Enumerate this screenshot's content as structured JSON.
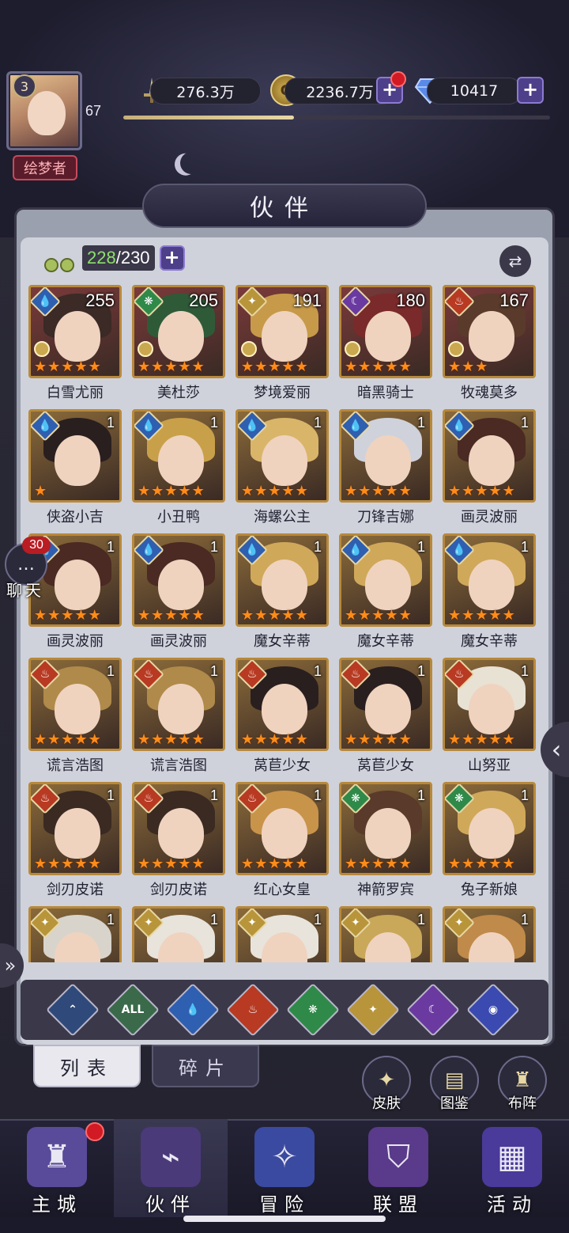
{
  "player": {
    "vip_level": "3",
    "level": "67",
    "title": "绘梦者",
    "exp_progress": 0.4
  },
  "resources": {
    "power": "276.3万",
    "gold": "2236.7万",
    "gems": "10417"
  },
  "header": {
    "title": "伙伴"
  },
  "roster": {
    "current": "228",
    "max": "/230"
  },
  "heroes": [
    {
      "name": "白雪尤丽",
      "level": "255",
      "element": "water",
      "stars": 5,
      "chess": true,
      "hair": "#3b2a26",
      "bg": "#7a3a3a"
    },
    {
      "name": "美杜莎",
      "level": "205",
      "element": "wind",
      "stars": 5,
      "chess": true,
      "hair": "#2f5a38",
      "bg": "#7a3a3a"
    },
    {
      "name": "梦境爱丽",
      "level": "191",
      "element": "light",
      "stars": 5,
      "chess": true,
      "hair": "#c79a4a",
      "bg": "#7a3a3a"
    },
    {
      "name": "暗黑骑士",
      "level": "180",
      "element": "dark",
      "stars": 5,
      "chess": true,
      "hair": "#7a2a2a",
      "bg": "#7a3a3a"
    },
    {
      "name": "牧魂莫多",
      "level": "167",
      "element": "fire",
      "stars": 3,
      "chess": true,
      "hair": "#5a3a2a",
      "bg": "#7a3a3a"
    },
    {
      "name": "侠盗小吉",
      "level": "1",
      "element": "water",
      "stars": 1,
      "chess": false,
      "hair": "#2a1f1f",
      "bg": "#8a6a3a"
    },
    {
      "name": "小丑鸭",
      "level": "1",
      "element": "water",
      "stars": 5,
      "chess": false,
      "hair": "#c9a04a",
      "bg": "#8a6a3a"
    },
    {
      "name": "海螺公主",
      "level": "1",
      "element": "water",
      "stars": 5,
      "chess": false,
      "hair": "#d9b56a",
      "bg": "#8a6a3a"
    },
    {
      "name": "刀锋吉娜",
      "level": "1",
      "element": "water",
      "stars": 5,
      "chess": false,
      "hair": "#cfd2db",
      "bg": "#8a6a3a"
    },
    {
      "name": "画灵波丽",
      "level": "1",
      "element": "water",
      "stars": 5,
      "chess": false,
      "hair": "#4a2a22",
      "bg": "#8a6a3a"
    },
    {
      "name": "画灵波丽",
      "level": "1",
      "element": "water",
      "stars": 5,
      "chess": false,
      "hair": "#4a2a22",
      "bg": "#8a6a3a"
    },
    {
      "name": "画灵波丽",
      "level": "1",
      "element": "water",
      "stars": 5,
      "chess": false,
      "hair": "#4a2a22",
      "bg": "#8a6a3a"
    },
    {
      "name": "魔女辛蒂",
      "level": "1",
      "element": "water",
      "stars": 5,
      "chess": false,
      "hair": "#d0a85a",
      "bg": "#8a6a3a"
    },
    {
      "name": "魔女辛蒂",
      "level": "1",
      "element": "water",
      "stars": 5,
      "chess": false,
      "hair": "#d0a85a",
      "bg": "#8a6a3a"
    },
    {
      "name": "魔女辛蒂",
      "level": "1",
      "element": "water",
      "stars": 5,
      "chess": false,
      "hair": "#d0a85a",
      "bg": "#8a6a3a"
    },
    {
      "name": "谎言浩图",
      "level": "1",
      "element": "fire",
      "stars": 5,
      "chess": false,
      "hair": "#b08a4a",
      "bg": "#8a6a3a"
    },
    {
      "name": "谎言浩图",
      "level": "1",
      "element": "fire",
      "stars": 5,
      "chess": false,
      "hair": "#b08a4a",
      "bg": "#8a6a3a"
    },
    {
      "name": "莴苣少女",
      "level": "1",
      "element": "fire",
      "stars": 5,
      "chess": false,
      "hair": "#2a1f1f",
      "bg": "#8a6a3a"
    },
    {
      "name": "莴苣少女",
      "level": "1",
      "element": "fire",
      "stars": 5,
      "chess": false,
      "hair": "#2a1f1f",
      "bg": "#8a6a3a"
    },
    {
      "name": "山努亚",
      "level": "1",
      "element": "fire",
      "stars": 5,
      "chess": false,
      "hair": "#e8e2d5",
      "bg": "#8a6a3a"
    },
    {
      "name": "剑刃皮诺",
      "level": "1",
      "element": "fire",
      "stars": 5,
      "chess": false,
      "hair": "#3a2a22",
      "bg": "#8a6a3a"
    },
    {
      "name": "剑刃皮诺",
      "level": "1",
      "element": "fire",
      "stars": 5,
      "chess": false,
      "hair": "#3a2a22",
      "bg": "#8a6a3a"
    },
    {
      "name": "红心女皇",
      "level": "1",
      "element": "fire",
      "stars": 5,
      "chess": false,
      "hair": "#c8944a",
      "bg": "#8a6a3a"
    },
    {
      "name": "神箭罗宾",
      "level": "1",
      "element": "wind",
      "stars": 5,
      "chess": false,
      "hair": "#5a3a2a",
      "bg": "#8a6a3a"
    },
    {
      "name": "兔子新娘",
      "level": "1",
      "element": "wind",
      "stars": 5,
      "chess": false,
      "hair": "#d0a85a",
      "bg": "#8a6a3a"
    },
    {
      "name": "",
      "level": "1",
      "element": "light",
      "stars": 0,
      "chess": false,
      "hair": "#d8d4cc",
      "bg": "#8a6a3a"
    },
    {
      "name": "",
      "level": "1",
      "element": "light",
      "stars": 0,
      "chess": false,
      "hair": "#e8e4dc",
      "bg": "#8a6a3a"
    },
    {
      "name": "",
      "level": "1",
      "element": "light",
      "stars": 0,
      "chess": false,
      "hair": "#e8e4dc",
      "bg": "#8a6a3a"
    },
    {
      "name": "",
      "level": "1",
      "element": "light",
      "stars": 0,
      "chess": false,
      "hair": "#c9a85a",
      "bg": "#8a6a3a"
    },
    {
      "name": "",
      "level": "1",
      "element": "light",
      "stars": 0,
      "chess": false,
      "hair": "#c08a4a",
      "bg": "#8a6a3a"
    }
  ],
  "element_colors": {
    "water": "#2f5fb0",
    "wind": "#2f8a4a",
    "light": "#b8953a",
    "dark": "#6a3aa0",
    "fire": "#b83a22"
  },
  "filters": [
    {
      "label": "",
      "icon": "chevron-up-icon",
      "color": "#2f4a7a"
    },
    {
      "label": "ALL",
      "icon": "all-icon",
      "color": "#3a6a4a"
    },
    {
      "label": "",
      "icon": "water-icon",
      "color": "#2f5fb0"
    },
    {
      "label": "",
      "icon": "fire-icon",
      "color": "#b83a22"
    },
    {
      "label": "",
      "icon": "wind-icon",
      "color": "#2f8a4a"
    },
    {
      "label": "",
      "icon": "light-icon",
      "color": "#b8953a"
    },
    {
      "label": "",
      "icon": "moon-icon",
      "color": "#6a3aa0"
    },
    {
      "label": "",
      "icon": "planet-icon",
      "color": "#3a4ab0"
    }
  ],
  "tabs": {
    "list": "列表",
    "fragments": "碎片"
  },
  "side_buttons": {
    "skin": "皮肤",
    "codex": "图鉴",
    "formation": "布阵"
  },
  "chat": {
    "badge": "30",
    "label": "聊天"
  },
  "nav": [
    {
      "label": "主城",
      "icon": "castle-icon"
    },
    {
      "label": "伙伴",
      "icon": "hat-icon"
    },
    {
      "label": "冒险",
      "icon": "compass-icon"
    },
    {
      "label": "联盟",
      "icon": "shield-icon"
    },
    {
      "label": "活动",
      "icon": "cards-icon"
    }
  ]
}
